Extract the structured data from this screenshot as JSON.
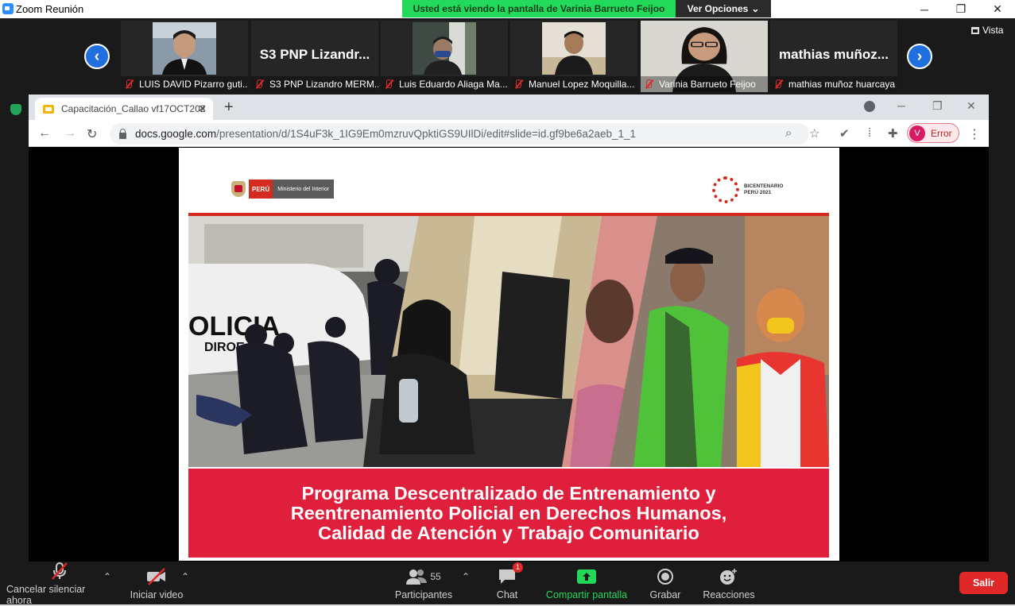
{
  "window": {
    "title": "Zoom Reunión",
    "minimize": "─",
    "maximize": "❐",
    "close": "✕"
  },
  "share_banner": {
    "text": "Usted está viendo la pantalla de Varinia Barrueto Feijoo",
    "options_label": "Ver Opciones"
  },
  "view_button": {
    "label": "Vista"
  },
  "gallery": {
    "prev_icon": "‹",
    "next_icon": "›",
    "tiles": [
      {
        "label": "LUIS DAVID Pizarro guti...",
        "big_name": "",
        "has_video": true
      },
      {
        "label": "S3 PNP Lizandro MERM...",
        "big_name": "S3 PNP Lizandr...",
        "has_video": false
      },
      {
        "label": "Luis Eduardo Aliaga Ma...",
        "big_name": "",
        "has_video": true
      },
      {
        "label": "Manuel Lopez Moquilla...",
        "big_name": "",
        "has_video": true
      },
      {
        "label": "Varinia Barrueto Feijoo",
        "big_name": "",
        "has_video": true
      },
      {
        "label": "mathias muñoz huarcaya",
        "big_name": "mathias muñoz...",
        "has_video": false
      }
    ]
  },
  "browser": {
    "tab_title": "Capacitación_Callao vf17OCT202",
    "tab_close": "✕",
    "new_tab": "+",
    "url_host": "docs.google.com",
    "url_path": "/presentation/d/1S4uF3k_1IG9Em0mzruvQpktiGS9UIlDi/edit#slide=id.gf9be6a2aeb_1_1",
    "profile_initial": "V",
    "profile_status": "Error"
  },
  "slide": {
    "peru_label": "PERÚ",
    "ministry_label": "Ministerio del Interior",
    "bicentenario_line1": "BICENTENARIO",
    "bicentenario_line2": "PERÚ 2021",
    "photo_text_policia": "OLICIA",
    "photo_text_diroe": "DIROE",
    "title_line1": "Programa Descentralizado de Entrenamiento y",
    "title_line2": "Reentrenamiento Policial en Derechos Humanos,",
    "title_line3": "Calidad de Atención y Trabajo Comunitario"
  },
  "toolbar": {
    "mute_label": "Cancelar silenciar ahora",
    "video_label": "Iniciar video",
    "participants_label": "Participantes",
    "participants_count": "55",
    "chat_label": "Chat",
    "chat_badge": "1",
    "share_label": "Compartir pantalla",
    "record_label": "Grabar",
    "reactions_label": "Reacciones",
    "leave_label": "Salir"
  },
  "colors": {
    "share_green": "#23d959",
    "zoom_blue": "#1f6fe0",
    "leave_red": "#e02828",
    "slide_red": "#e01f3d"
  }
}
